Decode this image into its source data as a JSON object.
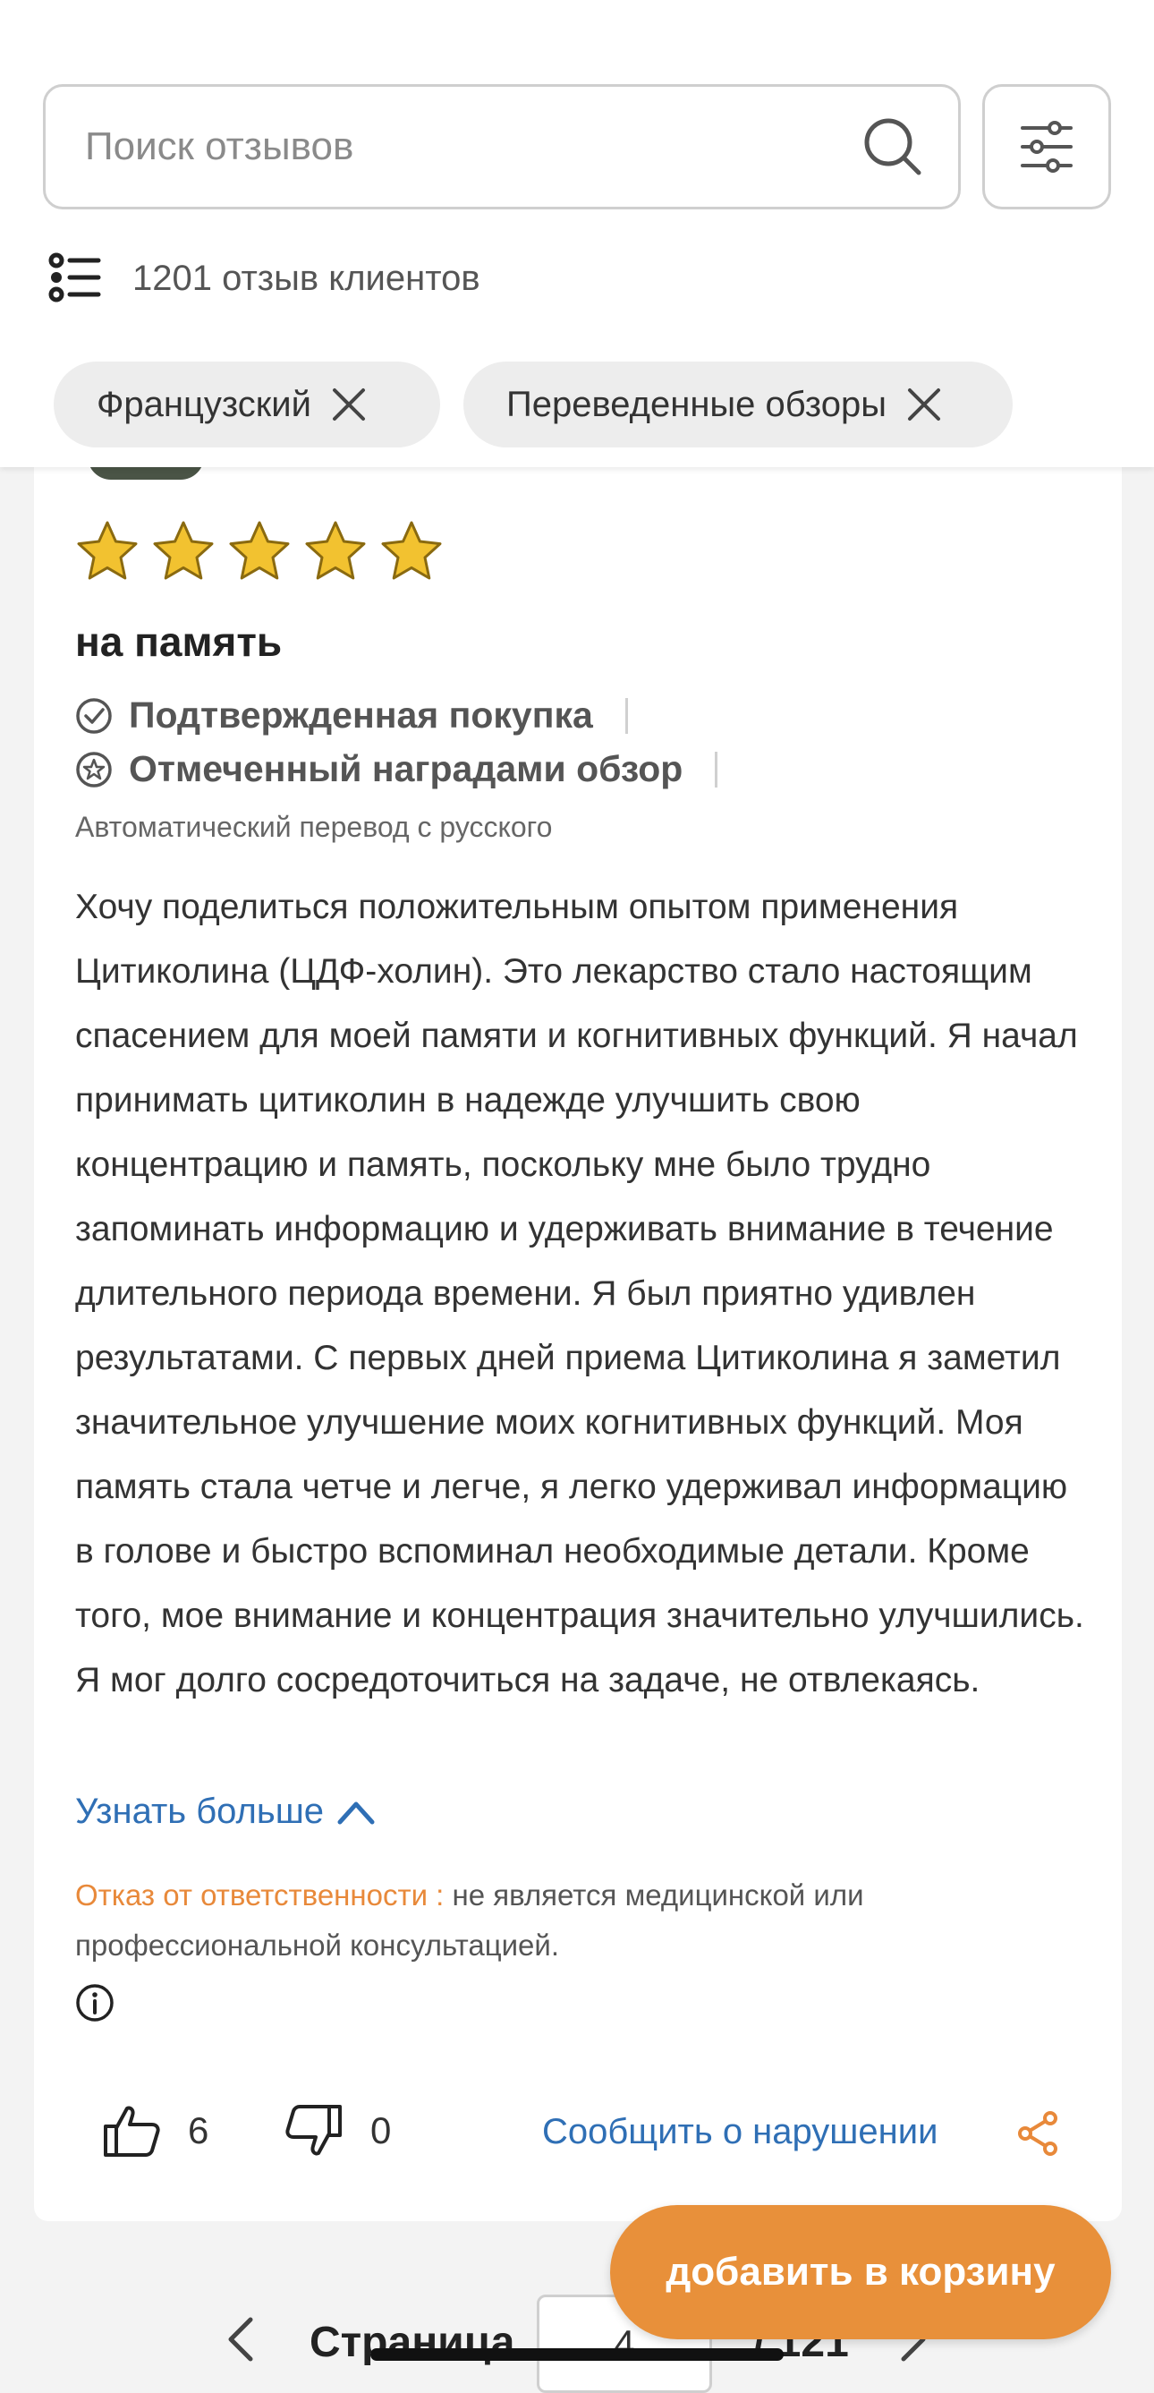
{
  "search": {
    "placeholder": "Поиск отзывов"
  },
  "reviews_count": "1201 отзыв клиентов",
  "filters": [
    {
      "label": "Французский"
    },
    {
      "label": "Переведенные обзоры"
    }
  ],
  "review": {
    "rating": 5,
    "title": "на память",
    "badges": [
      {
        "label": "Подтвержденная покупка",
        "icon": "check-circle-icon"
      },
      {
        "label": "Отмеченный наградами обзор",
        "icon": "award-star-icon"
      }
    ],
    "translation_note": "Автоматический перевод с русского",
    "body": "Хочу поделиться положительным опытом применения Цитиколина (ЦДФ-холин). Это лекарство стало настоящим спасением для моей памяти и когнитивных функций. Я начал принимать цитиколин в надежде улучшить свою концентрацию и память, поскольку мне было трудно запоминать информацию и удерживать внимание в течение длительного периода времени. Я был приятно удивлен результатами. С первых дней приема Цитиколина я заметил значительное улучшение моих когнитивных функций. Моя память стала четче и легче, я легко удерживал информацию в голове и быстро вспоминал необходимые детали. Кроме того, мое внимание и концентрация значительно улучшились. Я мог долго сосредоточиться на задаче, не отвлекаясь.",
    "more_label": "Узнать больше",
    "disclaimer_label": "Отказ от ответственности :",
    "disclaimer_text": " не является медицинской или профессиональной консультацией.",
    "likes": "6",
    "dislikes": "0",
    "report_label": "Сообщить о нарушении"
  },
  "pagination": {
    "label": "Страница",
    "current": "4",
    "total": "/ 121"
  },
  "cart_button": "добавить в корзину",
  "colors": {
    "accent_orange": "#e8903a",
    "link_blue": "#2f6fb5",
    "star_gold": "#f2c230"
  }
}
